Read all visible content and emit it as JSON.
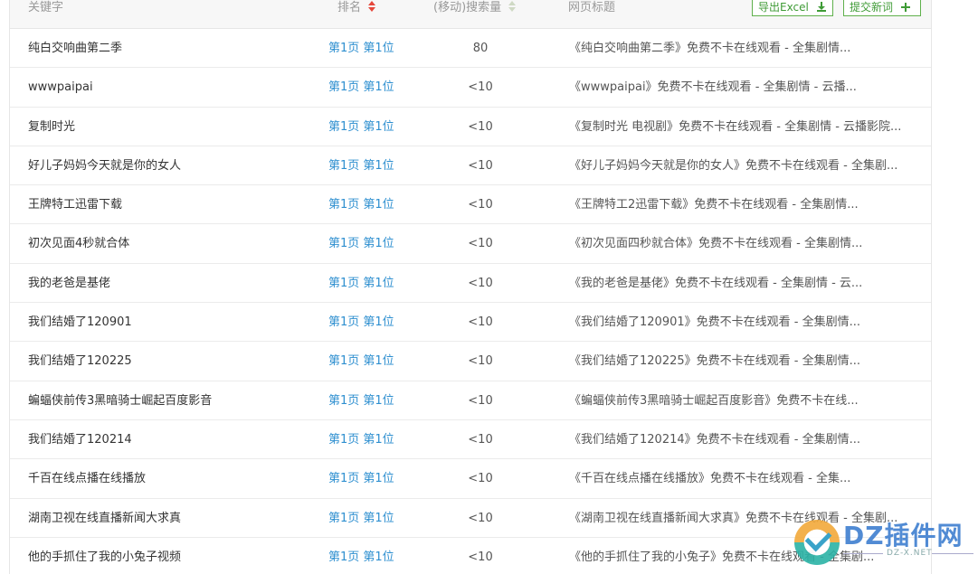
{
  "header": {
    "keyword": "关键字",
    "rank": "排名",
    "volume": "(移动)搜索量",
    "title": "网页标题",
    "export_button": "导出Excel",
    "add_button": "提交新词"
  },
  "rows": [
    {
      "keyword": "纯白交响曲第二季",
      "rank": "第1页 第1位",
      "volume": "80",
      "title": "《纯白交响曲第二季》免费不卡在线观看 - 全集剧情..."
    },
    {
      "keyword": "wwwpaipai",
      "rank": "第1页 第1位",
      "volume": "<10",
      "title": "《wwwpaipai》免费不卡在线观看 - 全集剧情 - 云播..."
    },
    {
      "keyword": "复制时光",
      "rank": "第1页 第1位",
      "volume": "<10",
      "title": "《复制时光 电视剧》免费不卡在线观看 - 全集剧情 - 云播影院..."
    },
    {
      "keyword": "好儿子妈妈今天就是你的女人",
      "rank": "第1页 第1位",
      "volume": "<10",
      "title": "《好儿子妈妈今天就是你的女人》免费不卡在线观看 - 全集剧..."
    },
    {
      "keyword": "王牌特工迅雷下载",
      "rank": "第1页 第1位",
      "volume": "<10",
      "title": "《王牌特工2迅雷下载》免费不卡在线观看 - 全集剧情..."
    },
    {
      "keyword": "初次见面4秒就合体",
      "rank": "第1页 第1位",
      "volume": "<10",
      "title": "《初次见面四秒就合体》免费不卡在线观看 - 全集剧情..."
    },
    {
      "keyword": "我的老爸是基佬",
      "rank": "第1页 第1位",
      "volume": "<10",
      "title": "《我的老爸是基佬》免费不卡在线观看 - 全集剧情 - 云..."
    },
    {
      "keyword": "我们结婚了120901",
      "rank": "第1页 第1位",
      "volume": "<10",
      "title": "《我们结婚了120901》免费不卡在线观看 - 全集剧情..."
    },
    {
      "keyword": "我们结婚了120225",
      "rank": "第1页 第1位",
      "volume": "<10",
      "title": "《我们结婚了120225》免费不卡在线观看 - 全集剧情..."
    },
    {
      "keyword": "蝙蝠侠前传3黑暗骑士崛起百度影音",
      "rank": "第1页 第1位",
      "volume": "<10",
      "title": "《蝙蝠侠前传3黑暗骑士崛起百度影音》免费不卡在线..."
    },
    {
      "keyword": "我们结婚了120214",
      "rank": "第1页 第1位",
      "volume": "<10",
      "title": "《我们结婚了120214》免费不卡在线观看 - 全集剧情..."
    },
    {
      "keyword": "千百在线点播在线播放",
      "rank": "第1页 第1位",
      "volume": "<10",
      "title": "《千百在线点播在线播放》免费不卡在线观看 - 全集..."
    },
    {
      "keyword": "湖南卫视在线直播新闻大求真",
      "rank": "第1页 第1位",
      "volume": "<10",
      "title": "《湖南卫视在线直播新闻大求真》免费不卡在线观看 - 全集剧..."
    },
    {
      "keyword": "他的手抓住了我的小兔子视频",
      "rank": "第1页 第1位",
      "volume": "<10",
      "title": "《他的手抓住了我的小兔子》免费不卡在线观看 - 全集剧..."
    }
  ],
  "watermark": {
    "logo_text": "DZ插件网",
    "sub_text": "DZ-X.NET"
  },
  "icons": {
    "rank_sort": "sort-arrows-icon",
    "volume_sort": "sort-arrows-icon",
    "export": "download-icon",
    "add": "plus-icon"
  },
  "colors": {
    "rank_link": "#2e8fd0",
    "button_border": "#5fb04c",
    "sort_active": "#e5473b"
  }
}
